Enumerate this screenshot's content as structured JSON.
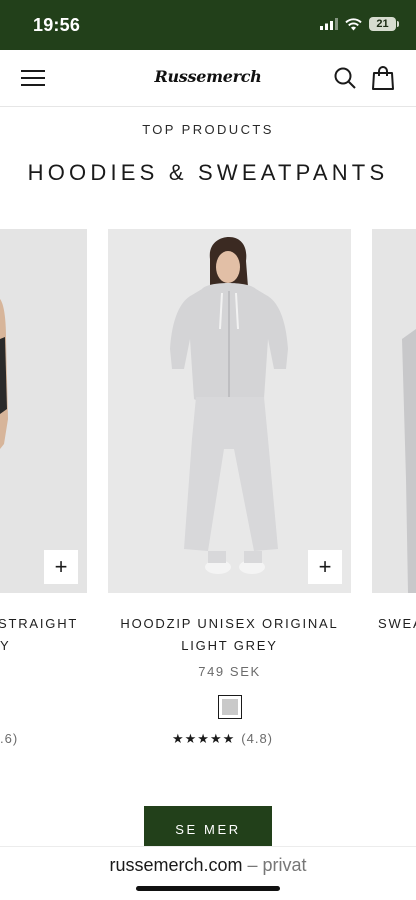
{
  "status_bar": {
    "time": "19:56",
    "battery": "21",
    "background": "#22401a"
  },
  "header": {
    "logo": "Russemerch",
    "menu_icon": "hamburger-menu-icon",
    "search_icon": "search-icon",
    "cart_icon": "shopping-bag-icon"
  },
  "section": {
    "eyebrow": "TOP PRODUCTS",
    "title": "HOODIES & SWEATPANTS"
  },
  "products": [
    {
      "title_line1": "STRAIGHT",
      "title_line2": "Y",
      "rating_tail": ".6)",
      "add_label": "+"
    },
    {
      "title_line1": "HOODZIP UNISEX ORIGINAL",
      "title_line2": "LIGHT GREY",
      "price": "749 SEK",
      "swatch_color": "#c9c9c9",
      "stars": "★★★★★",
      "rating": "(4.8)",
      "add_label": "+"
    },
    {
      "title_line1": "SWEA"
    }
  ],
  "cta": {
    "label": "SE MER",
    "color": "#22401a"
  },
  "browser": {
    "domain": "russemerch.com",
    "separator": "–",
    "mode": "privat"
  }
}
